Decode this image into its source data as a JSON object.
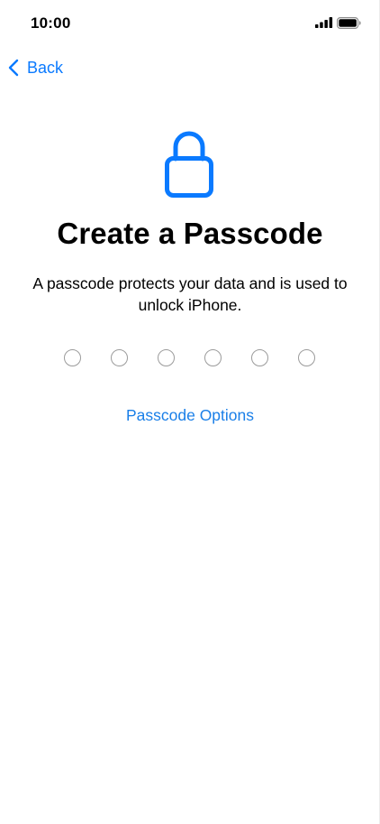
{
  "status_bar": {
    "time": "10:00",
    "signal_icon": "cellular-signal-icon",
    "battery_icon": "battery-icon"
  },
  "nav": {
    "back_label": "Back",
    "back_icon": "chevron-left-icon"
  },
  "main": {
    "icon": "lock-icon",
    "title": "Create a Passcode",
    "description": "A passcode protects your data and is used to unlock iPhone.",
    "passcode_length": 6,
    "passcode_filled": 0,
    "options_label": "Passcode Options"
  },
  "colors": {
    "accent": "#0a7aff",
    "text": "#000000",
    "dot_border": "#9b9b9b",
    "background": "#ffffff"
  }
}
